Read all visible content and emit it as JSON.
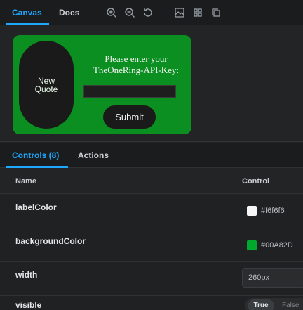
{
  "toolbar": {
    "tabs": [
      {
        "label": "Canvas",
        "active": true
      },
      {
        "label": "Docs",
        "active": false
      }
    ],
    "tools": [
      "zoom-in-icon",
      "zoom-out-icon",
      "reset-zoom-icon",
      "background-icon",
      "grid-icon",
      "outline-icon"
    ]
  },
  "preview": {
    "quote_button_label": "New Quote",
    "prompt_text": "Please enter your TheOneRing-API-Key:",
    "api_key_value": "",
    "submit_label": "Submit",
    "card_background": "#00A82D",
    "label_color": "#f6f6f6"
  },
  "panel": {
    "tabs": [
      {
        "label": "Controls (8)",
        "active": true
      },
      {
        "label": "Actions",
        "active": false
      }
    ]
  },
  "table": {
    "headers": {
      "name": "Name",
      "control": "Control"
    },
    "rows": [
      {
        "name": "labelColor",
        "value": "#f6f6f6",
        "swatch": "#f6f6f6"
      },
      {
        "name": "backgroundColor",
        "value": "#00A82D",
        "swatch": "#00A82D"
      },
      {
        "name": "width",
        "value": "260px"
      },
      {
        "name": "visible",
        "true_label": "True",
        "false_label": "False"
      }
    ]
  }
}
